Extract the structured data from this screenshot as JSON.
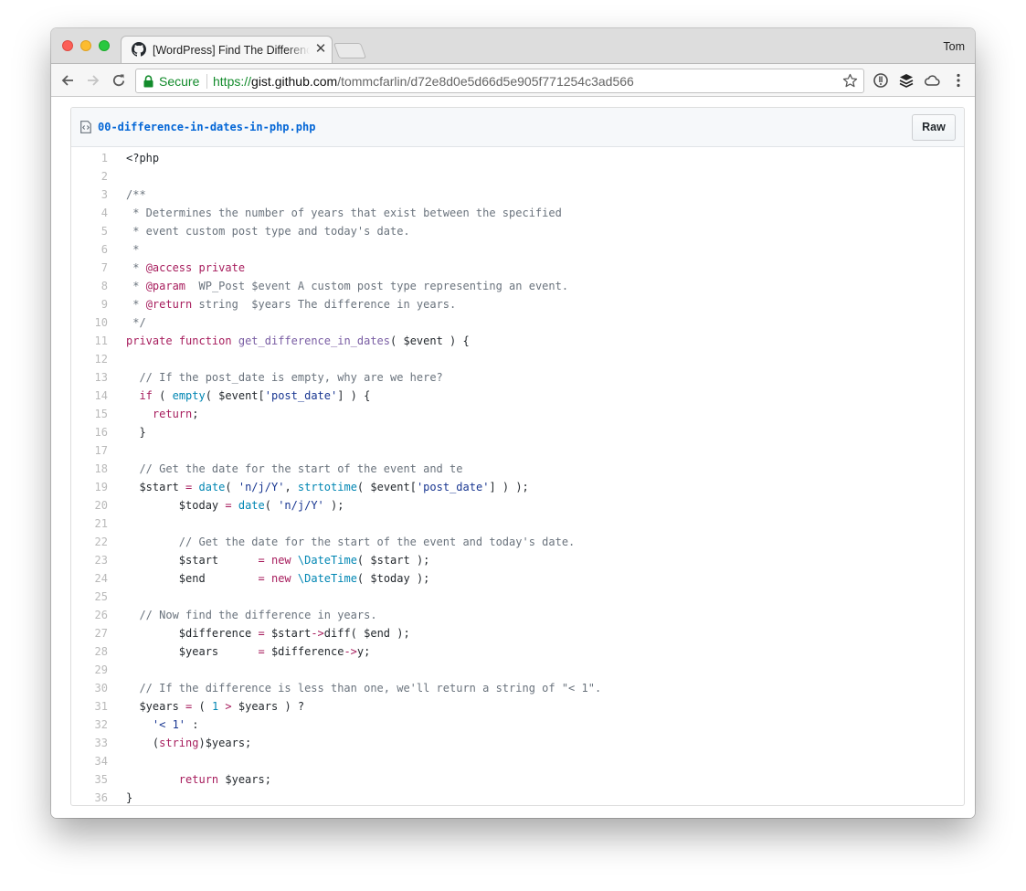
{
  "browser": {
    "tab_title": "[WordPress] Find The Difference In Dates In PHP",
    "profile_name": "Tom",
    "secure_label": "Secure",
    "url_scheme": "https://",
    "url_host": "gist.github.com",
    "url_path": "/tommcfarlin/d72e8d0e5d66d5e905f771254c3ad566"
  },
  "file": {
    "name": "00-difference-in-dates-in-php.php",
    "raw_label": "Raw"
  },
  "code_lines": [
    [
      {
        "t": "<?php"
      }
    ],
    [],
    [
      {
        "t": "/**",
        "c": "c"
      }
    ],
    [
      {
        "t": " * Determines the number of years that exist between the specified",
        "c": "c"
      }
    ],
    [
      {
        "t": " * event custom post type and today's date.",
        "c": "c"
      }
    ],
    [
      {
        "t": " *",
        "c": "c"
      }
    ],
    [
      {
        "t": " * ",
        "c": "c"
      },
      {
        "t": "@access",
        "c": "k"
      },
      {
        "t": " ",
        "c": "c"
      },
      {
        "t": "private",
        "c": "k"
      }
    ],
    [
      {
        "t": " * ",
        "c": "c"
      },
      {
        "t": "@param",
        "c": "k"
      },
      {
        "t": "  WP_Post $event A custom post type representing an event.",
        "c": "c"
      }
    ],
    [
      {
        "t": " * ",
        "c": "c"
      },
      {
        "t": "@return",
        "c": "k"
      },
      {
        "t": " string  $years The difference in years.",
        "c": "c"
      }
    ],
    [
      {
        "t": " */",
        "c": "c"
      }
    ],
    [
      {
        "t": "private",
        "c": "k"
      },
      {
        "t": " "
      },
      {
        "t": "function",
        "c": "k"
      },
      {
        "t": " "
      },
      {
        "t": "get_difference_in_dates",
        "c": "f"
      },
      {
        "t": "( $event ) {"
      }
    ],
    [],
    [
      {
        "t": "  "
      },
      {
        "t": "// If the post_date is empty, why are we here?",
        "c": "c"
      }
    ],
    [
      {
        "t": "  "
      },
      {
        "t": "if",
        "c": "k"
      },
      {
        "t": " ( "
      },
      {
        "t": "empty",
        "c": "b"
      },
      {
        "t": "( $event["
      },
      {
        "t": "'post_date'",
        "c": "s"
      },
      {
        "t": "] ) {"
      }
    ],
    [
      {
        "t": "    "
      },
      {
        "t": "return",
        "c": "k"
      },
      {
        "t": ";"
      }
    ],
    [
      {
        "t": "  }"
      }
    ],
    [],
    [
      {
        "t": "  "
      },
      {
        "t": "// Get the date for the start of the event and te",
        "c": "c"
      }
    ],
    [
      {
        "t": "  $start "
      },
      {
        "t": "=",
        "c": "k"
      },
      {
        "t": " "
      },
      {
        "t": "date",
        "c": "b"
      },
      {
        "t": "( "
      },
      {
        "t": "'n/j/Y'",
        "c": "s"
      },
      {
        "t": ", "
      },
      {
        "t": "strtotime",
        "c": "b"
      },
      {
        "t": "( $event["
      },
      {
        "t": "'post_date'",
        "c": "s"
      },
      {
        "t": "] ) );"
      }
    ],
    [
      {
        "t": "        $today "
      },
      {
        "t": "=",
        "c": "k"
      },
      {
        "t": " "
      },
      {
        "t": "date",
        "c": "b"
      },
      {
        "t": "( "
      },
      {
        "t": "'n/j/Y'",
        "c": "s"
      },
      {
        "t": " );"
      }
    ],
    [],
    [
      {
        "t": "        "
      },
      {
        "t": "// Get the date for the start of the event and today's date.",
        "c": "c"
      }
    ],
    [
      {
        "t": "        $start      "
      },
      {
        "t": "=",
        "c": "k"
      },
      {
        "t": " "
      },
      {
        "t": "new",
        "c": "k"
      },
      {
        "t": " "
      },
      {
        "t": "\\DateTime",
        "c": "n"
      },
      {
        "t": "( $start );"
      }
    ],
    [
      {
        "t": "        $end        "
      },
      {
        "t": "=",
        "c": "k"
      },
      {
        "t": " "
      },
      {
        "t": "new",
        "c": "k"
      },
      {
        "t": " "
      },
      {
        "t": "\\DateTime",
        "c": "n"
      },
      {
        "t": "( $today );"
      }
    ],
    [],
    [
      {
        "t": "  "
      },
      {
        "t": "// Now find the difference in years.",
        "c": "c"
      }
    ],
    [
      {
        "t": "        $difference "
      },
      {
        "t": "=",
        "c": "k"
      },
      {
        "t": " $start"
      },
      {
        "t": "->",
        "c": "k"
      },
      {
        "t": "diff( $end );"
      }
    ],
    [
      {
        "t": "        $years      "
      },
      {
        "t": "=",
        "c": "k"
      },
      {
        "t": " $difference"
      },
      {
        "t": "->",
        "c": "k"
      },
      {
        "t": "y;"
      }
    ],
    [],
    [
      {
        "t": "  "
      },
      {
        "t": "// If the difference is less than one, we'll return a string of \"< 1\".",
        "c": "c"
      }
    ],
    [
      {
        "t": "  $years "
      },
      {
        "t": "=",
        "c": "k"
      },
      {
        "t": " ( "
      },
      {
        "t": "1",
        "c": "n"
      },
      {
        "t": " "
      },
      {
        "t": ">",
        "c": "k"
      },
      {
        "t": " $years ) ?"
      }
    ],
    [
      {
        "t": "    "
      },
      {
        "t": "'< 1'",
        "c": "s"
      },
      {
        "t": " :"
      }
    ],
    [
      {
        "t": "    ("
      },
      {
        "t": "string",
        "c": "k"
      },
      {
        "t": ")$years;"
      }
    ],
    [],
    [
      {
        "t": "        "
      },
      {
        "t": "return",
        "c": "k"
      },
      {
        "t": " $years;"
      }
    ],
    [
      {
        "t": "}"
      }
    ]
  ],
  "colors": {
    "link_blue": "#0366d6",
    "secure_green": "#128b2b",
    "comment_gray": "#6a737d",
    "keyword_red": "#a71d5d",
    "function_purple": "#795da3",
    "string_navy": "#183691",
    "builtin_blue": "#0086b3"
  },
  "icons": {
    "tab_favicon": "github-icon",
    "back": "back-arrow-icon",
    "forward": "forward-arrow-icon",
    "reload": "reload-icon",
    "lock": "lock-icon",
    "bookmark": "star-icon",
    "extensions": [
      "info-circle-icon",
      "layers-icon",
      "cloud-icon",
      "menu-dots-icon"
    ],
    "file": "code-file-icon"
  }
}
